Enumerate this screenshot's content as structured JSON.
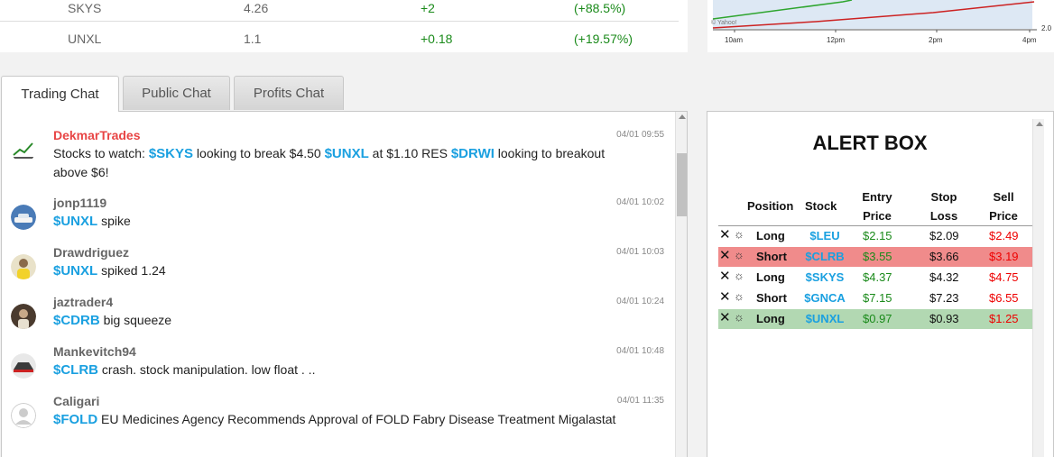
{
  "quotes": [
    {
      "symbol": "SKYS",
      "price": "4.26",
      "change": "+2",
      "percent": "(+88.5%)"
    },
    {
      "symbol": "UNXL",
      "price": "1.1",
      "change": "+0.18",
      "percent": "(+19.57%)"
    }
  ],
  "mini_chart": {
    "ticks": [
      "10am",
      "12pm",
      "2pm",
      "4pm"
    ],
    "y_value": "2.0",
    "watermark": "© Yahoo!",
    "colors": {
      "green_line": "#2ea52e",
      "red_line": "#cc2222",
      "fill": "#dde8f4"
    }
  },
  "tabs": [
    {
      "label": "Trading Chat",
      "active": true
    },
    {
      "label": "Public Chat",
      "active": false
    },
    {
      "label": "Profits Chat",
      "active": false
    }
  ],
  "chat": {
    "messages": [
      {
        "user": "DekmarTrades",
        "time": "04/01 09:55",
        "avatar": "chart-logo",
        "parts": [
          {
            "t": "Stocks to watch: "
          },
          {
            "tk": "$SKYS"
          },
          {
            "t": " looking to break $4.50 "
          },
          {
            "tk": "$UNXL"
          },
          {
            "t": " at $1.10 RES "
          },
          {
            "tk": "$DRWI"
          },
          {
            "t": " looking to breakout above $6!"
          }
        ]
      },
      {
        "user": "jonp1119",
        "time": "04/01 10:02",
        "avatar": "car-photo",
        "parts": [
          {
            "tk": "$UNXL"
          },
          {
            "t": " spike"
          }
        ]
      },
      {
        "user": "Drawdriguez",
        "time": "04/01 10:03",
        "avatar": "person-yellow",
        "parts": [
          {
            "tk": "$UNXL"
          },
          {
            "t": " spiked 1.24"
          }
        ]
      },
      {
        "user": "jaztrader4",
        "time": "04/01 10:24",
        "avatar": "person-dark",
        "parts": [
          {
            "tk": "$CDRB"
          },
          {
            "t": " big squeeze"
          }
        ]
      },
      {
        "user": "Mankevitch94",
        "time": "04/01 10:48",
        "avatar": "car-dark",
        "parts": [
          {
            "tk": "$CLRB"
          },
          {
            "t": " crash. stock manipulation. low float . .."
          }
        ]
      },
      {
        "user": "Caligari",
        "time": "04/01 11:35",
        "avatar": "default-user",
        "parts": [
          {
            "tk": "$FOLD"
          },
          {
            "t": " EU Medicines Agency Recommends Approval of FOLD Fabry Disease Treatment Migalastat"
          }
        ]
      }
    ]
  },
  "alert_box": {
    "title": "ALERT BOX",
    "headers": {
      "position": "Position",
      "stock": "Stock",
      "entry_1": "Entry",
      "entry_2": "Price",
      "stop_1": "Stop",
      "stop_2": "Loss",
      "sell_1": "Sell",
      "sell_2": "Price"
    },
    "rows": [
      {
        "position": "Long",
        "stock": "$LEU",
        "entry": "$2.15",
        "stop": "$2.09",
        "sell": "$2.49",
        "highlight": "none"
      },
      {
        "position": "Short",
        "stock": "$CLRB",
        "entry": "$3.55",
        "stop": "$3.66",
        "sell": "$3.19",
        "highlight": "red"
      },
      {
        "position": "Long",
        "stock": "$SKYS",
        "entry": "$4.37",
        "stop": "$4.32",
        "sell": "$4.75",
        "highlight": "none"
      },
      {
        "position": "Short",
        "stock": "$GNCA",
        "entry": "$7.15",
        "stop": "$7.23",
        "sell": "$6.55",
        "highlight": "none"
      },
      {
        "position": "Long",
        "stock": "$UNXL",
        "entry": "$0.97",
        "stop": "$0.93",
        "sell": "$1.25",
        "highlight": "green"
      }
    ],
    "colors": {
      "ticker": "#1aa0e0",
      "entry": "#1a8a1a",
      "sell": "#e00000",
      "red_row": "#f08b8b",
      "green_row": "#b2d8b2"
    }
  }
}
